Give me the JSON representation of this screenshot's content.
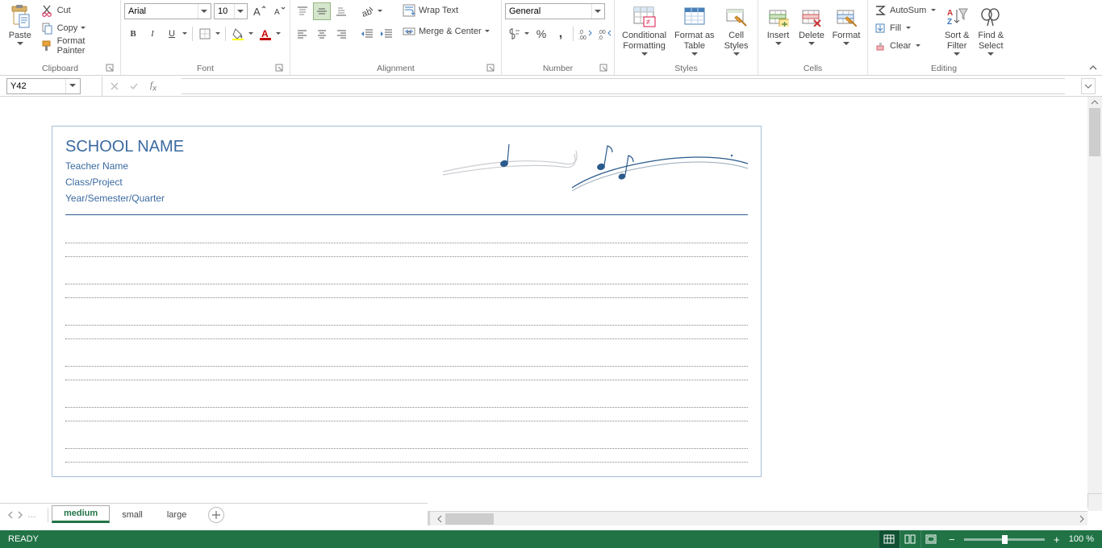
{
  "ribbon": {
    "clipboard": {
      "label": "Clipboard",
      "paste": "Paste",
      "cut": "Cut",
      "copy": "Copy",
      "format_painter": "Format Painter"
    },
    "font": {
      "label": "Font",
      "font_name": "Arial",
      "font_size": "10"
    },
    "alignment": {
      "label": "Alignment",
      "wrap_text": "Wrap Text",
      "merge_center": "Merge & Center"
    },
    "number": {
      "label": "Number",
      "format": "General"
    },
    "styles": {
      "label": "Styles",
      "conditional": "Conditional\nFormatting",
      "format_as_table": "Format as\nTable",
      "cell_styles": "Cell\nStyles"
    },
    "cells": {
      "label": "Cells",
      "insert": "Insert",
      "delete": "Delete",
      "format": "Format"
    },
    "editing": {
      "label": "Editing",
      "autosum": "AutoSum",
      "fill": "Fill",
      "clear": "Clear",
      "sort_filter": "Sort &\nFilter",
      "find_select": "Find &\nSelect"
    }
  },
  "namebox": {
    "value": "Y42"
  },
  "formula_bar": {
    "value": ""
  },
  "document": {
    "title": "SCHOOL NAME",
    "teacher": "Teacher Name",
    "class": "Class/Project",
    "term": "Year/Semester/Quarter"
  },
  "sheets": {
    "tabs": [
      "medium",
      "small",
      "large"
    ],
    "active": "medium"
  },
  "statusbar": {
    "status": "READY",
    "zoom": "100 %"
  }
}
